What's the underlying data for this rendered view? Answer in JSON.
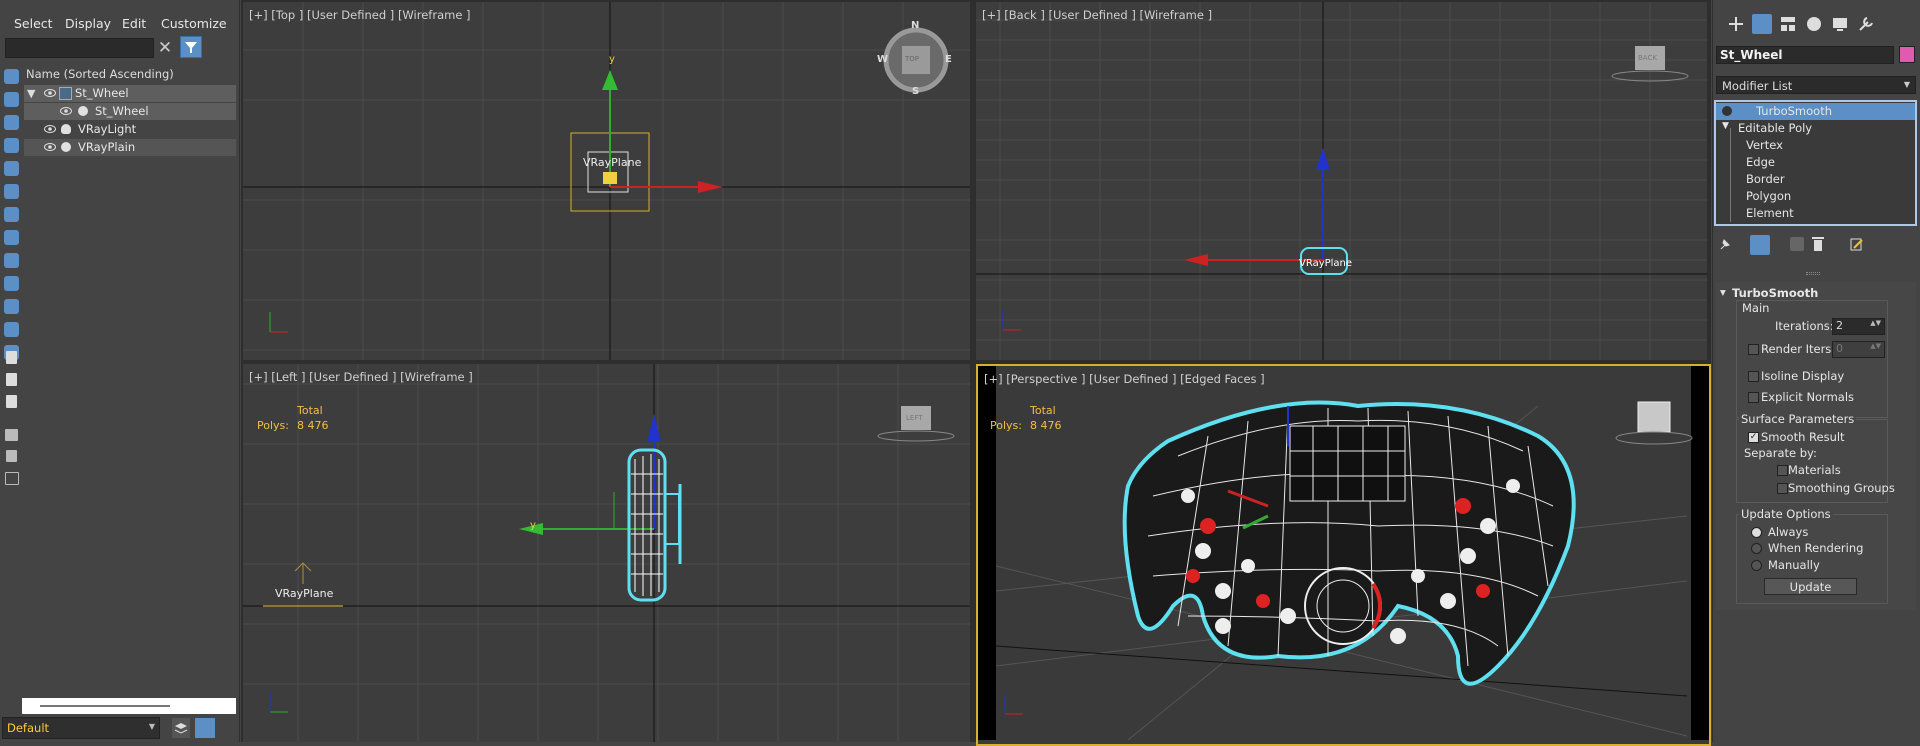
{
  "menu": {
    "select": "Select",
    "display": "Display",
    "edit": "Edit",
    "customize": "Customize"
  },
  "explorer": {
    "filter_placeholder": "",
    "list_header": "Name (Sorted Ascending)",
    "items": [
      {
        "label": "St_Wheel"
      },
      {
        "label": "St_Wheel"
      },
      {
        "label": "VRayLight"
      },
      {
        "label": "VRayPlain"
      }
    ],
    "layer": "Default"
  },
  "viewports": {
    "top": {
      "label": "[+] [Top ] [User Defined ] [Wireframe ]",
      "object_label": "VRayPlane",
      "axis_y": "y",
      "cube_n": "N",
      "cube_s": "S",
      "cube_w": "W",
      "cube_e": "E",
      "cube_face": "TOP"
    },
    "back": {
      "label": "[+] [Back ] [User Defined ] [Wireframe ]",
      "object_label": "VRayPlane",
      "cube_face": "BACK"
    },
    "left": {
      "label": "[+] [Left ] [User Defined ] [Wireframe ]",
      "object_label": "VRayPlane",
      "axis_y": "y",
      "cube_face": "LEFT",
      "stat_title": "Total",
      "stat_label": "Polys:",
      "stat_value": "8 476"
    },
    "persp": {
      "label": "[+] [Perspective ] [User Defined ] [Edged Faces ]",
      "stat_title": "Total",
      "stat_label": "Polys:",
      "stat_value": "8 476"
    }
  },
  "command_panel": {
    "object_name": "St_Wheel",
    "object_color": "#e05ab0",
    "modifier_list": "Modifier List",
    "stack": [
      {
        "label": "TurboSmooth",
        "selected": true
      },
      {
        "label": "Editable Poly"
      },
      {
        "label": "Vertex"
      },
      {
        "label": "Edge"
      },
      {
        "label": "Border"
      },
      {
        "label": "Polygon"
      },
      {
        "label": "Element"
      }
    ],
    "rollout": {
      "title": "TurboSmooth",
      "main": "Main",
      "iterations_label": "Iterations:",
      "iterations_value": "2",
      "render_iters_label": "Render Iters:",
      "render_iters_value": "0",
      "isoline": "Isoline Display",
      "explicit": "Explicit Normals",
      "surface_params": "Surface Parameters",
      "smooth_result": "Smooth Result",
      "separate_by": "Separate by:",
      "materials": "Materials",
      "smoothing_groups": "Smoothing Groups",
      "update_options": "Update Options",
      "always": "Always",
      "when_rendering": "When Rendering",
      "manually": "Manually",
      "update_button": "Update"
    }
  },
  "colors": {
    "accent": "#5c8fc6",
    "selection": "#f0c040",
    "wire_highlight": "#5ee0f0"
  }
}
